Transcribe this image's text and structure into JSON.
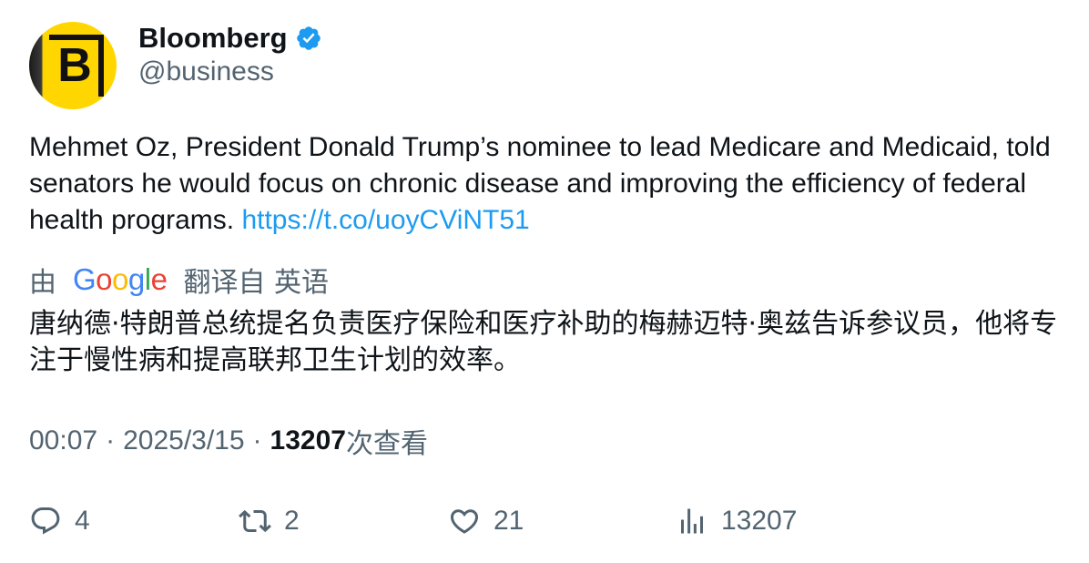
{
  "author": {
    "display_name": "Bloomberg",
    "handle": "@business",
    "avatar_letter": "B",
    "verified": true
  },
  "tweet": {
    "text": "Mehmet Oz, President Donald Trump’s nominee to lead Medicare and Medicaid, told senators he would focus on chronic disease and improving the efficiency of federal health programs. ",
    "link": "https://t.co/uoyCViNT51"
  },
  "translation": {
    "prefix": "由",
    "provider": "Google",
    "suffix": "翻译自 英语",
    "text": "唐纳德·特朗普总统提名负责医疗保险和医疗补助的梅赫迈特·奥兹告诉参议员，他将专注于慢性病和提高联邦卫生计划的效率。"
  },
  "meta": {
    "time": "00:07",
    "separator": "·",
    "date": "2025/3/15",
    "views_count": "13207",
    "views_label": "次查看"
  },
  "actions": {
    "reply_count": "4",
    "retweet_count": "2",
    "like_count": "21",
    "views_count": "13207"
  },
  "colors": {
    "link": "#1d9bf0",
    "secondary_text": "#536471",
    "primary_text": "#0f1419",
    "verified_badge": "#1d9bf0",
    "avatar_background": "#ffd600"
  },
  "icons": {
    "verified": "verified-badge-icon",
    "reply": "reply-icon",
    "retweet": "retweet-icon",
    "like": "heart-icon",
    "views": "views-bar-chart-icon"
  }
}
